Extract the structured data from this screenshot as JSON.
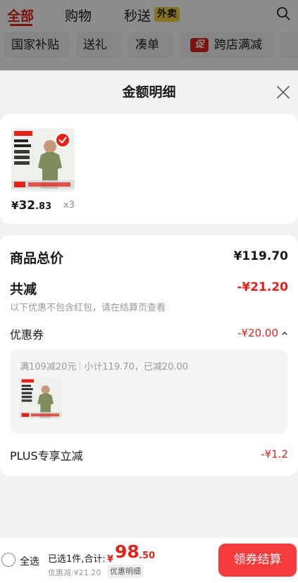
{
  "top_tabs": {
    "all": "全部",
    "shopping": "购物",
    "fast": "秒送",
    "waimai_badge": "外卖"
  },
  "filter_chips": [
    "国家补贴",
    "送礼",
    "凑单",
    "跨店满减"
  ],
  "promo_icon_label": "促",
  "sheet": {
    "title": "金额明细"
  },
  "product": {
    "price_yen": "¥",
    "price_int": "32",
    "price_dec": ".83",
    "quantity": "x3"
  },
  "summary": {
    "total_label": "商品总价",
    "total_value": "¥119.70",
    "reduce_label": "共减",
    "reduce_value": "-¥21.20",
    "reduce_note": "以下优惠不包含红包，请在结算页查看",
    "coupon_label": "优惠券",
    "coupon_value": "-¥20.00",
    "coupon_rule": "满109减20元",
    "coupon_detail": "小计119.70，已减20.00",
    "plus_label": "PLUS专享立减",
    "plus_value": "-¥1.2"
  },
  "bottom_bar": {
    "select_all": "全选",
    "selected_text": "已选1件,合计:",
    "sum_yen": "¥",
    "sum_int": "98",
    "sum_dec": ".50",
    "discount_text": "优惠减:¥21.20",
    "detail_tag": "优惠明细",
    "checkout": "领券结算"
  },
  "colors": {
    "accent": "#e2231a",
    "checkout_button": "#f53b3b",
    "waimai_badge": "#f7d23c"
  }
}
